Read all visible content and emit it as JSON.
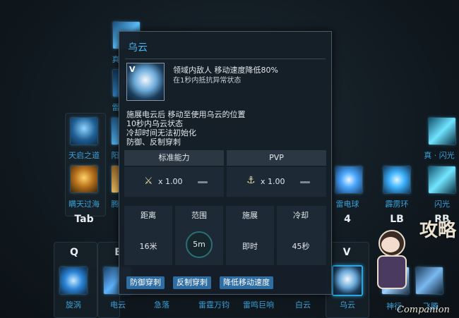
{
  "skillbar": {
    "top_right_labels": {
      "zhen_shanguang": "真 · 闪光",
      "shanguang": "闪光",
      "pilihuan": "霹雳环"
    },
    "left_labels": {
      "tianqi": "天启之道",
      "qingtian": "瞒天过海",
      "wang": "真",
      "lei": "雷",
      "bai": "阳",
      "teng": "腾"
    },
    "key_labels": {
      "tab": "Tab",
      "num4": "4",
      "lb": "LB",
      "rb": "RB",
      "q": "Q",
      "e": "E",
      "v": "V"
    },
    "mid_labels": {
      "leidianqiu": "雷电球"
    },
    "bottom_labels": {
      "xuanwo": "旋涡",
      "dianyun": "电云",
      "jiluo": "急落",
      "leitingwanjun": "雷霆万钧",
      "leimingjuxiang": "雷鸣巨响",
      "baiyun": "白云",
      "wuyun": "乌云",
      "shenhe": "神行",
      "feiteng": "飞腾"
    }
  },
  "tooltip": {
    "title": "乌云",
    "icon_key": "V",
    "effect_line1": "领域内敌人 移动速度降低80%",
    "effect_line2": "在1秒内抵抗异常状态",
    "desc_line1": "施展电云后 移动至使用乌云的位置",
    "desc_line2": "10秒内乌云状态",
    "desc_line3": "冷却时间无法初始化",
    "desc_line4": "防御、反制穿刺",
    "standard_header": "标准能力",
    "pvp_header": "PVP",
    "standard_mult": "x 1.00",
    "pvp_mult": "x 1.00",
    "stats": {
      "distance_label": "距离",
      "range_label": "范围",
      "cast_label": "施展",
      "cooldown_label": "冷却",
      "distance_value": "16米",
      "range_value": "5m",
      "cast_value": "即时",
      "cooldown_value": "45秒"
    },
    "tags": [
      "防御穿刺",
      "反制穿刺",
      "降低移动速度"
    ]
  },
  "watermark": {
    "chars": "攻略",
    "latin": "Companion"
  },
  "colors": {
    "accent": "#46b3f0",
    "label_blue": "#3aa0d8",
    "tag_bg": "#2f6ea3"
  }
}
